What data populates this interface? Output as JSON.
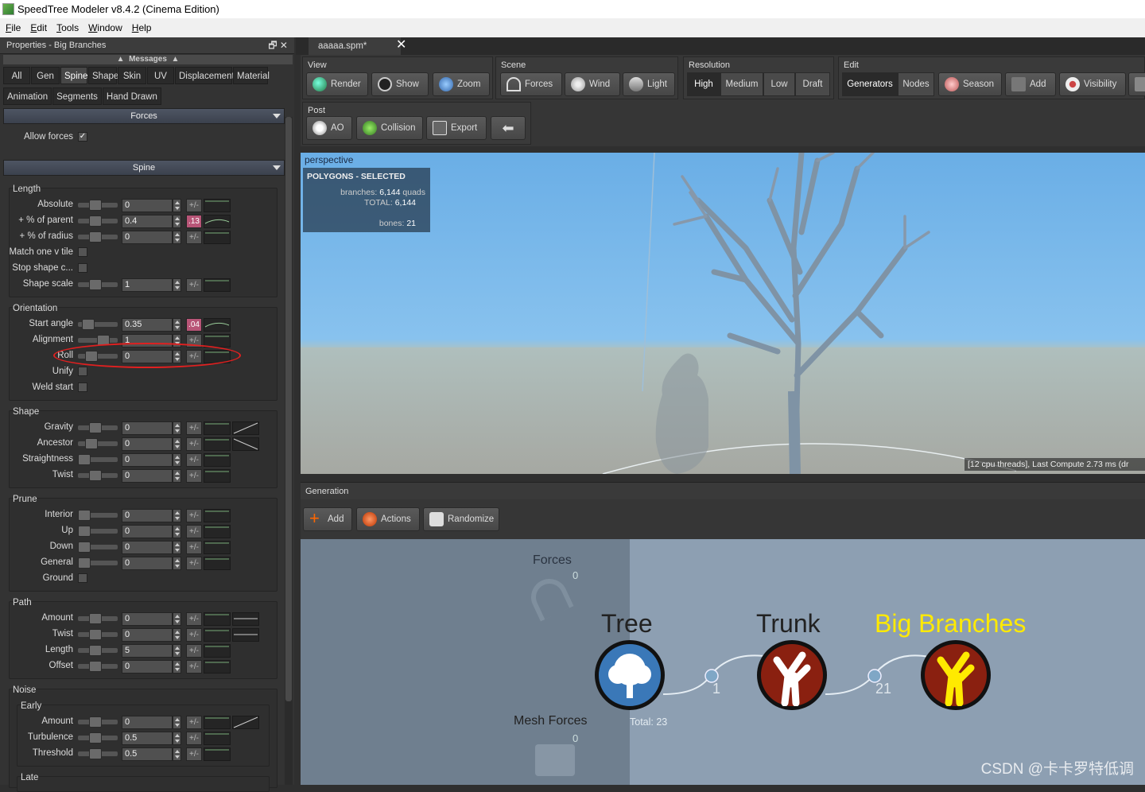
{
  "window": {
    "title": "SpeedTree Modeler v8.4.2 (Cinema Edition)"
  },
  "menu": [
    "File",
    "Edit",
    "Tools",
    "Window",
    "Help"
  ],
  "left_panel": {
    "title": "Properties - Big Branches",
    "messages": "Messages",
    "tabs_row1": [
      "All",
      "Gen",
      "Spine",
      "Shape",
      "Skin",
      "UV",
      "Displacement",
      "Material"
    ],
    "tabs_row2": [
      "Animation",
      "Segments",
      "Hand Drawn"
    ],
    "selected_tab": "Spine",
    "sections": {
      "forces": "Forces",
      "spine": "Spine"
    },
    "allow_forces": {
      "label": "Allow forces",
      "checked": true
    },
    "groups": {
      "length": "Length",
      "orientation": "Orientation",
      "shape": "Shape",
      "prune": "Prune",
      "path": "Path",
      "noise": "Noise",
      "early": "Early",
      "late": "Late"
    },
    "pm": "+/-",
    "length_rows": [
      {
        "label": "Absolute",
        "value": "0"
      },
      {
        "label": "+ % of parent",
        "value": "0.4",
        "pm": ".13"
      },
      {
        "label": "+ % of radius",
        "value": "0"
      }
    ],
    "match_one": "Match one v tile",
    "stop_shape": "Stop shape c...",
    "shape_scale": {
      "label": "Shape scale",
      "value": "1"
    },
    "orientation_rows": [
      {
        "label": "Start angle",
        "value": "0.35",
        "pm": ".04"
      },
      {
        "label": "Alignment",
        "value": "1"
      },
      {
        "label": "Roll",
        "value": "0"
      }
    ],
    "unify": "Unify",
    "weld_start": "Weld start",
    "shape_rows": [
      {
        "label": "Gravity",
        "value": "0"
      },
      {
        "label": "Ancestor",
        "value": "0"
      },
      {
        "label": "Straightness",
        "value": "0"
      },
      {
        "label": "Twist",
        "value": "0"
      }
    ],
    "prune_rows": [
      {
        "label": "Interior",
        "value": "0"
      },
      {
        "label": "Up",
        "value": "0"
      },
      {
        "label": "Down",
        "value": "0"
      },
      {
        "label": "General",
        "value": "0"
      }
    ],
    "ground": "Ground",
    "path_rows": [
      {
        "label": "Amount",
        "value": "0"
      },
      {
        "label": "Twist",
        "value": "0"
      },
      {
        "label": "Length",
        "value": "5"
      },
      {
        "label": "Offset",
        "value": "0"
      }
    ],
    "early_rows": [
      {
        "label": "Amount",
        "value": "0"
      },
      {
        "label": "Turbulence",
        "value": "0.5"
      },
      {
        "label": "Threshold",
        "value": "0.5"
      }
    ]
  },
  "doc_tab": {
    "label": "aaaaa.spm*"
  },
  "toolbar": {
    "view": {
      "label": "View",
      "buttons": [
        "Render",
        "Show",
        "Zoom"
      ]
    },
    "scene": {
      "label": "Scene",
      "buttons": [
        "Forces",
        "Wind",
        "Light"
      ]
    },
    "resolution": {
      "label": "Resolution",
      "options": [
        "High",
        "Medium",
        "Low",
        "Draft"
      ],
      "selected": "High"
    },
    "edit": {
      "label": "Edit",
      "tabs": [
        "Generators",
        "Nodes"
      ],
      "buttons": [
        "Season",
        "Add",
        "Visibility"
      ]
    },
    "post": {
      "label": "Post",
      "buttons": [
        "AO",
        "Collision",
        "Export"
      ]
    }
  },
  "viewport": {
    "label": "perspective",
    "overlay_title": "POLYGONS - SELECTED",
    "branches_label": "branches:",
    "branches_value": "6,144",
    "branches_unit": "quads",
    "total_label": "TOTAL:",
    "total_value": "6,144",
    "bones_label": "bones:",
    "bones_value": "21",
    "status": "[12 cpu threads], Last Compute 2.73 ms (dr"
  },
  "generation": {
    "title": "Generation",
    "buttons": [
      "Add",
      "Actions",
      "Randomize"
    ],
    "forces": {
      "label": "Forces",
      "count": "0"
    },
    "mesh_forces": {
      "label": "Mesh Forces",
      "count": "0"
    },
    "nodes": [
      {
        "label": "Tree"
      },
      {
        "label": "Trunk",
        "link_count": "1"
      },
      {
        "label": "Big Branches",
        "link_count": "21"
      }
    ],
    "total": "Total: 23"
  },
  "colors": {
    "selected_node": "#ffea00",
    "node_bg_tree": "#3a78b8",
    "node_bg_branch": "#8a2010"
  },
  "watermark": "CSDN @卡卡罗特低调"
}
